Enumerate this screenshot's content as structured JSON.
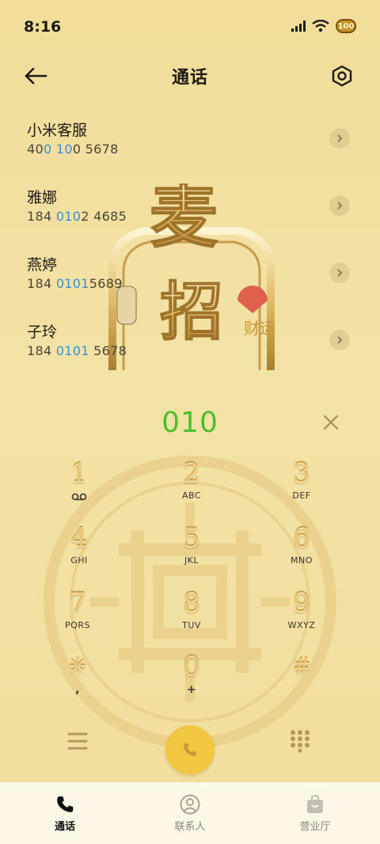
{
  "status_bar": {
    "time": "8:16",
    "battery_level": "100"
  },
  "header": {
    "title": "通话"
  },
  "contacts": [
    {
      "name": "小米客服",
      "number_parts": [
        "40",
        "0",
        " ",
        "10",
        "0 5678"
      ]
    },
    {
      "name": "雅娜",
      "number_parts": [
        "184 ",
        "010",
        "2 4685",
        "",
        ""
      ]
    },
    {
      "name": "燕婷",
      "number_parts": [
        "184 ",
        "0101",
        "5689",
        "",
        ""
      ]
    },
    {
      "name": "子玲",
      "number_parts": [
        "184 ",
        "0101",
        " 5678",
        "",
        ""
      ]
    }
  ],
  "dialer": {
    "input": "010"
  },
  "keypad": [
    {
      "digit": "1",
      "letters": ""
    },
    {
      "digit": "2",
      "letters": "ABC"
    },
    {
      "digit": "3",
      "letters": "DEF"
    },
    {
      "digit": "4",
      "letters": "GHI"
    },
    {
      "digit": "5",
      "letters": "JKL"
    },
    {
      "digit": "6",
      "letters": "MNO"
    },
    {
      "digit": "7",
      "letters": "PQRS"
    },
    {
      "digit": "8",
      "letters": "TUV"
    },
    {
      "digit": "9",
      "letters": "WXYZ"
    },
    {
      "digit": "✳",
      "letters": ","
    },
    {
      "digit": "0",
      "letters": "+"
    },
    {
      "digit": "#",
      "letters": ""
    }
  ],
  "bottom_nav": [
    {
      "label": "通话",
      "active": true
    },
    {
      "label": "联系人",
      "active": false
    },
    {
      "label": "营业厅",
      "active": false
    }
  ],
  "colors": {
    "background": "#f3df9c",
    "dial_input": "#4cbf2f",
    "highlight_match": "#3c8fd0",
    "call_button": "#f1c640",
    "key_gold": "#e9c777"
  },
  "icons": {
    "back": "arrow-left-icon",
    "settings": "hexagon-gear-icon",
    "voicemail": "voicemail-icon",
    "clear": "close-icon",
    "menu": "menu-icon",
    "call": "phone-icon",
    "keypad_toggle": "dialpad-icon"
  }
}
